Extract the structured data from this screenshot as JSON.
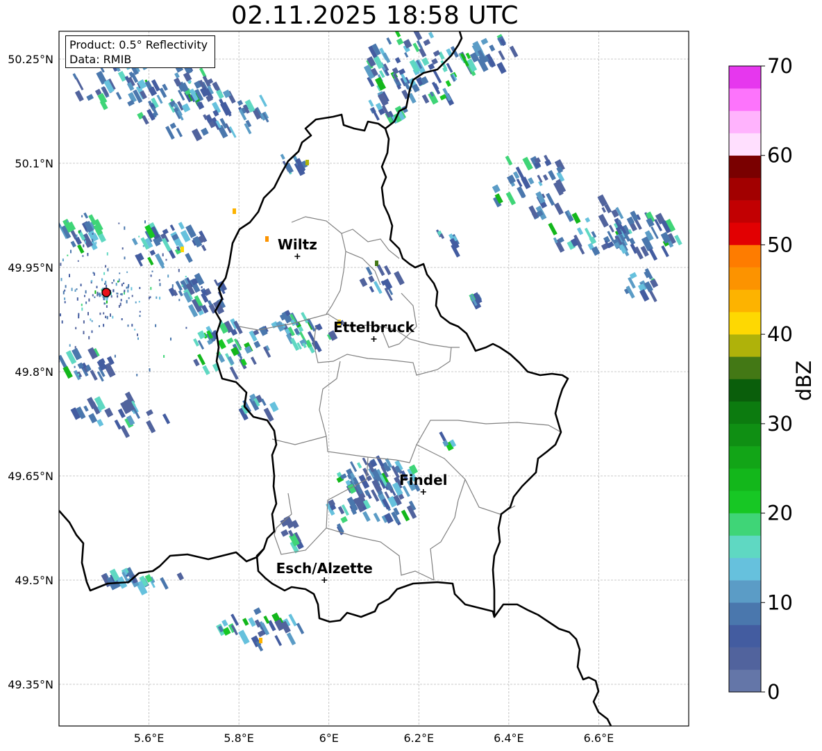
{
  "title": "02.11.2025 18:58 UTC",
  "info": {
    "product": "Product: 0.5° Reflectivity",
    "data": "Data: RMIB"
  },
  "map": {
    "lon_range": [
      5.4,
      6.8
    ],
    "lat_range": [
      49.29,
      50.29
    ],
    "lon_ticks": [
      "5.6°E",
      "5.8°E",
      "6°E",
      "6.2°E",
      "6.4°E",
      "6.6°E"
    ],
    "lat_ticks": [
      "50.25°N",
      "50.1°N",
      "49.95°N",
      "49.8°N",
      "49.65°N",
      "49.5°N",
      "49.35°N"
    ],
    "grid": true,
    "radar_site": {
      "lon": 5.505,
      "lat": 49.914,
      "color": "#e8101a"
    }
  },
  "cities": [
    {
      "name": "Wiltz",
      "lon": 5.93,
      "lat": 49.966
    },
    {
      "name": "Ettelbruck",
      "lon": 6.1,
      "lat": 49.847
    },
    {
      "name": "Findel",
      "lon": 6.21,
      "lat": 49.627
    },
    {
      "name": "Esch/Alzette",
      "lon": 5.99,
      "lat": 49.5
    }
  ],
  "colorbar": {
    "label": "dBZ",
    "min": 0,
    "max": 70,
    "tick_labels": [
      "0",
      "10",
      "20",
      "30",
      "40",
      "50",
      "60",
      "70"
    ],
    "colors": [
      "#6476a8",
      "#51639d",
      "#435ca0",
      "#4a77ad",
      "#5b9cc6",
      "#66c1dd",
      "#5fd8c2",
      "#3fd577",
      "#17c724",
      "#13b71b",
      "#12a517",
      "#0f8f13",
      "#0c7b0f",
      "#0a5e0b",
      "#437815",
      "#afb20a",
      "#fed802",
      "#fdb300",
      "#fc9300",
      "#fe7c00",
      "#e20002",
      "#c20002",
      "#a20000",
      "#7a0000",
      "#ffdffe",
      "#ffb3fd",
      "#fd74fc",
      "#e637ee"
    ]
  }
}
